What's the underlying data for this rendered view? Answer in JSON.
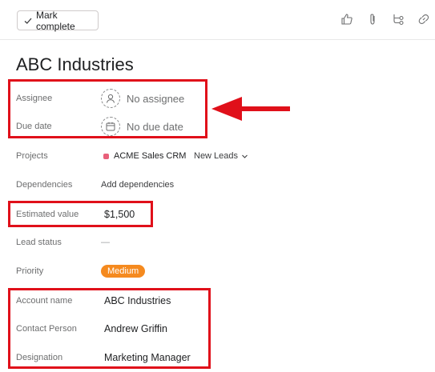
{
  "toolbar": {
    "mark_complete_label": "Mark complete",
    "icons": [
      "thumbs-up-icon",
      "attachment-icon",
      "subtasks-icon",
      "link-icon"
    ]
  },
  "task": {
    "title": "ABC Industries"
  },
  "fields": {
    "assignee": {
      "label": "Assignee",
      "value": "No assignee"
    },
    "due_date": {
      "label": "Due date",
      "value": "No due date"
    },
    "projects": {
      "label": "Projects",
      "project_name": "ACME Sales CRM",
      "section": "New Leads",
      "project_color": "#e8607a"
    },
    "dependencies": {
      "label": "Dependencies",
      "value": "Add dependencies"
    },
    "estimated_value": {
      "label": "Estimated value",
      "value": "$1,500"
    },
    "lead_status": {
      "label": "Lead status",
      "value": "—"
    },
    "priority": {
      "label": "Priority",
      "value": "Medium",
      "color": "#f58a1f"
    },
    "account_name": {
      "label": "Account name",
      "value": "ABC Industries"
    },
    "contact_person": {
      "label": "Contact Person",
      "value": "Andrew Griffin"
    },
    "designation": {
      "label": "Designation",
      "value": "Marketing Manager"
    }
  },
  "annotations": {
    "highlight_color": "#e0101a"
  }
}
